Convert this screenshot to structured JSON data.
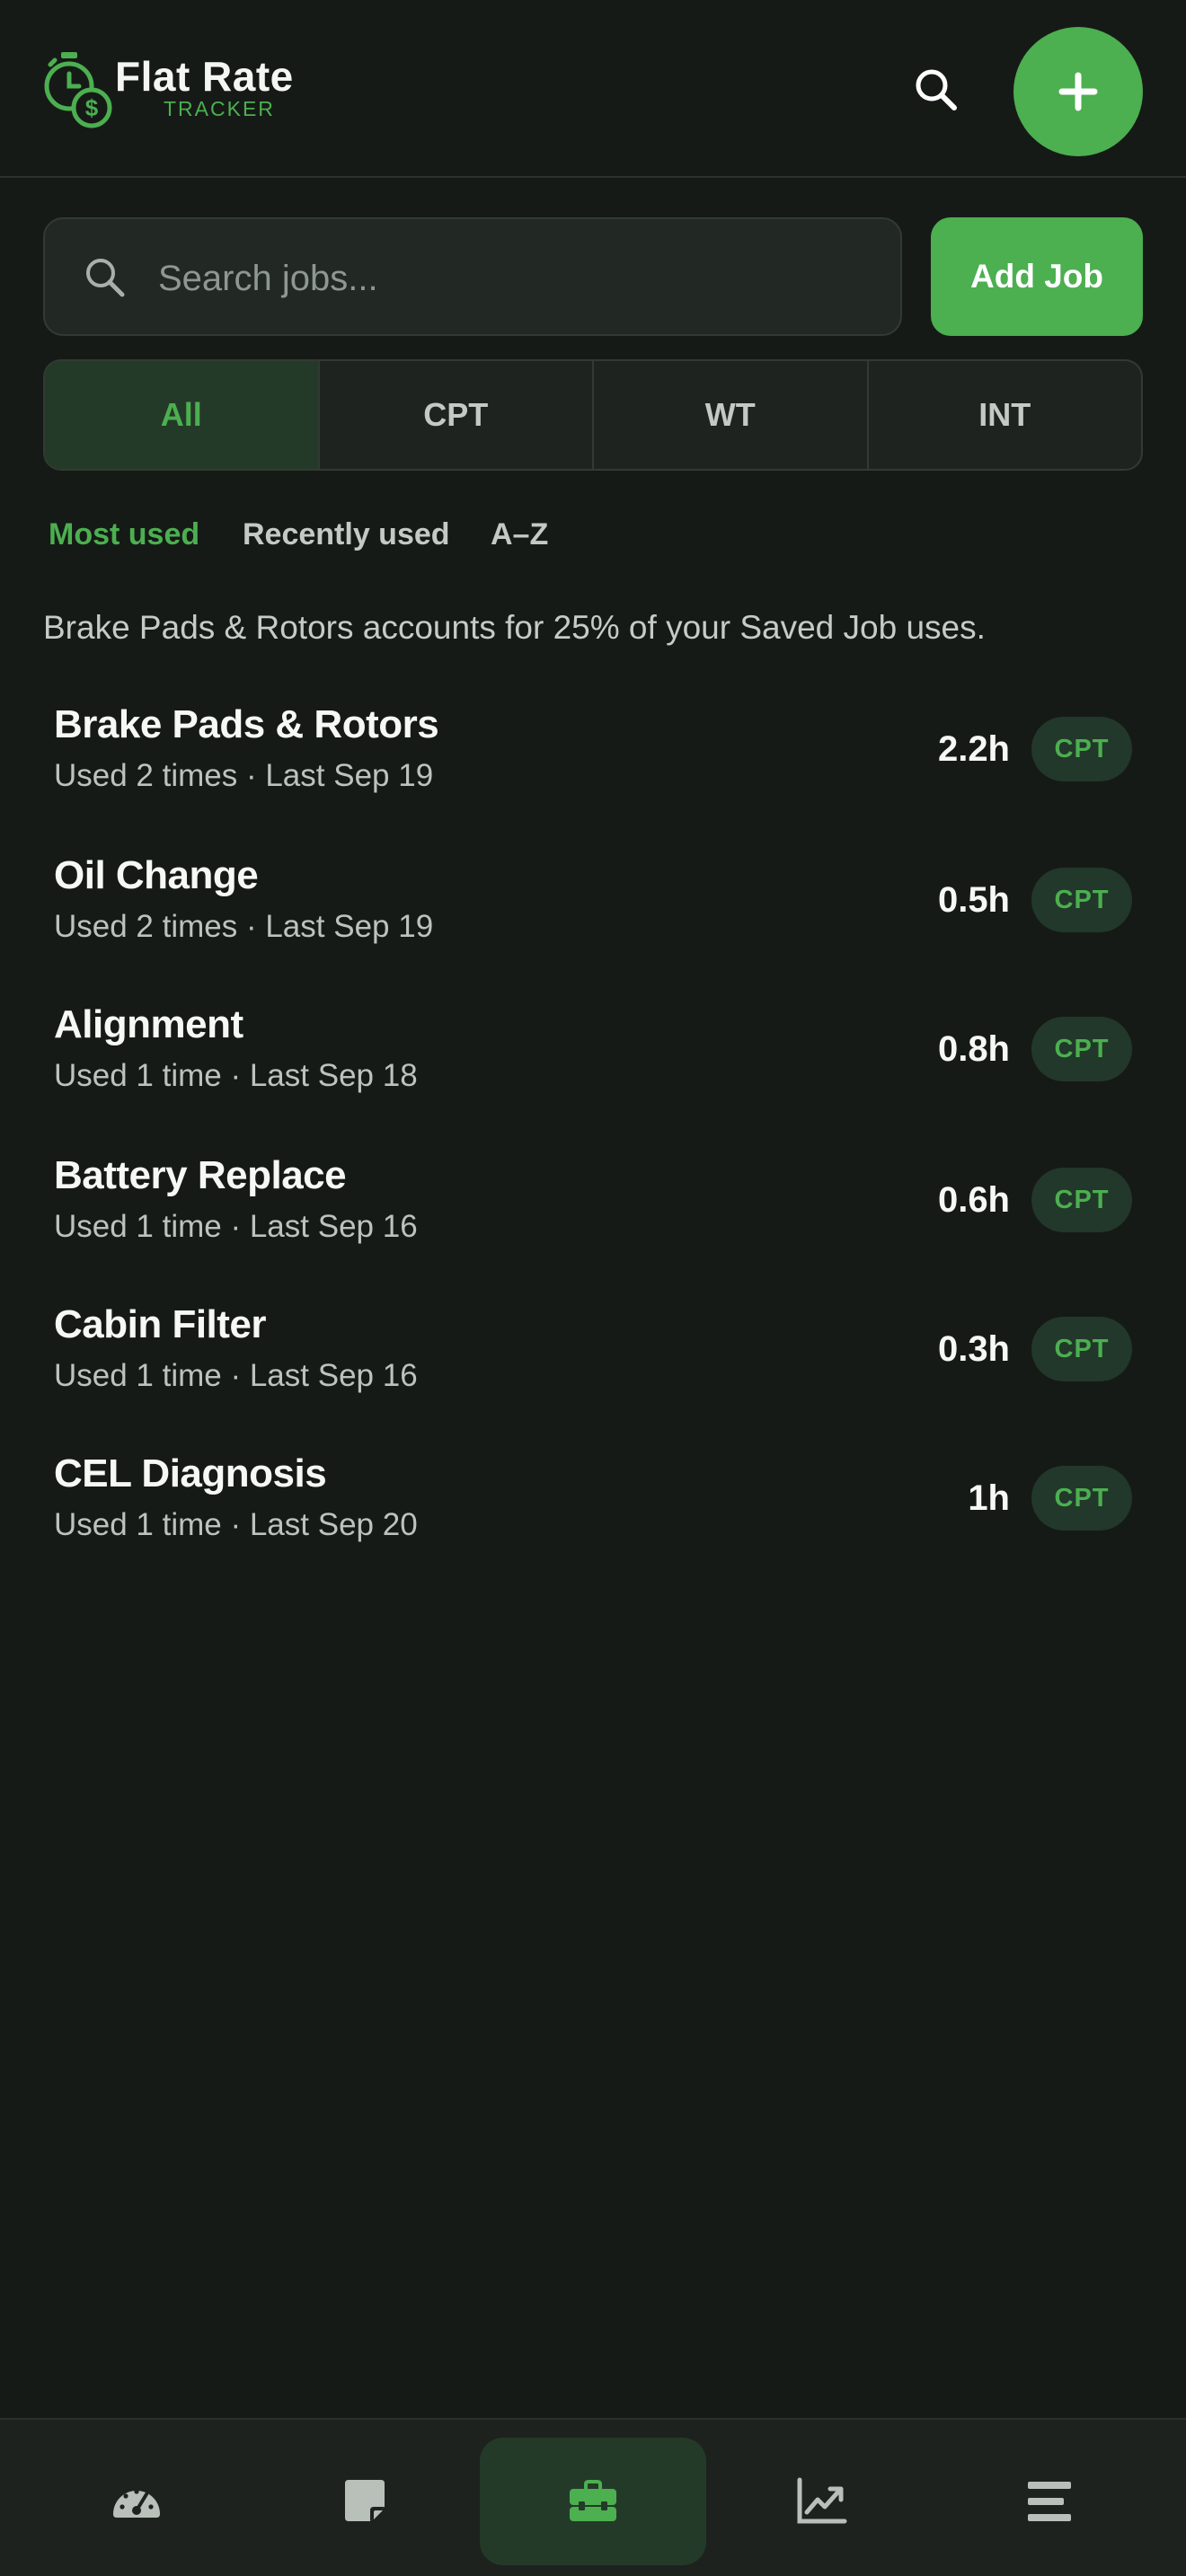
{
  "app": {
    "title": "Flat Rate",
    "subtitle": "TRACKER"
  },
  "search": {
    "placeholder": "Search jobs...",
    "add_job_label": "Add Job"
  },
  "filters": {
    "selected": "All",
    "options": [
      "All",
      "CPT",
      "WT",
      "INT"
    ]
  },
  "sort": {
    "selected": "Most used",
    "options": [
      "Most used",
      "Recently used",
      "A–Z"
    ]
  },
  "insight_text": "Brake Pads & Rotors accounts for 25% of your Saved Job uses.",
  "jobs": [
    {
      "name": "Brake Pads & Rotors",
      "meta": "Used 2 times · Last Sep 19",
      "hours": "2.2h",
      "type": "CPT"
    },
    {
      "name": "Oil Change",
      "meta": "Used 2 times · Last Sep 19",
      "hours": "0.5h",
      "type": "CPT"
    },
    {
      "name": "Alignment",
      "meta": "Used 1 time · Last Sep 18",
      "hours": "0.8h",
      "type": "CPT"
    },
    {
      "name": "Battery Replace",
      "meta": "Used 1 time · Last Sep 16",
      "hours": "0.6h",
      "type": "CPT"
    },
    {
      "name": "Cabin Filter",
      "meta": "Used 1 time · Last Sep 16",
      "hours": "0.3h",
      "type": "CPT"
    },
    {
      "name": "CEL Diagnosis",
      "meta": "Used 1 time · Last Sep 20",
      "hours": "1h",
      "type": "CPT"
    }
  ],
  "nav": {
    "active": "saved-jobs",
    "items": [
      {
        "icon": "speedometer-icon"
      },
      {
        "icon": "note-icon"
      },
      {
        "icon": "toolbox-icon"
      },
      {
        "icon": "chart-icon"
      },
      {
        "icon": "menu-icon"
      }
    ]
  },
  "colors": {
    "background": "#161a17",
    "accent": "#4caf50",
    "badge_bg": "#22382a"
  }
}
